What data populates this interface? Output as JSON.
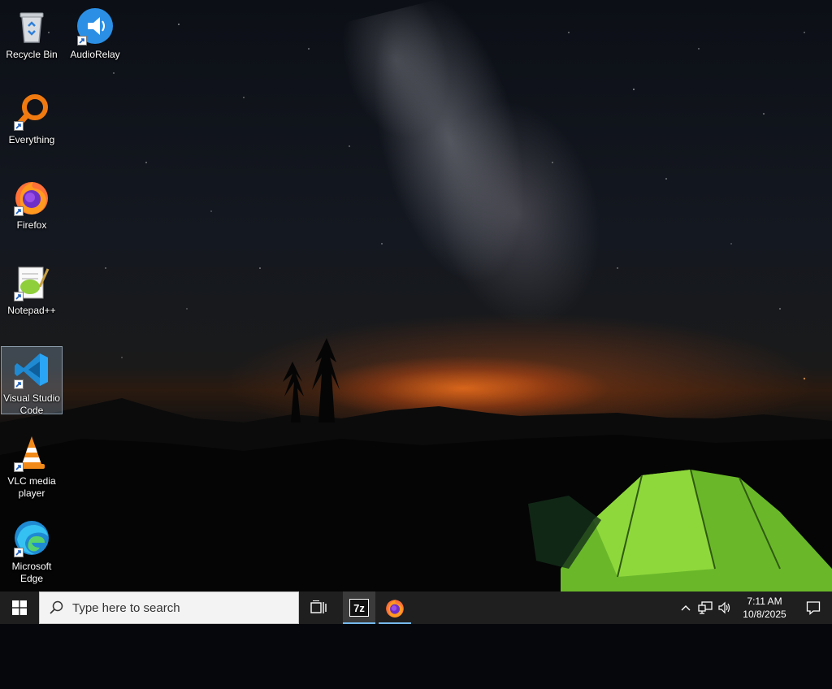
{
  "desktop": {
    "icons": [
      {
        "label": "Recycle Bin",
        "icon": "recycle-bin-icon"
      },
      {
        "label": "AudioRelay",
        "icon": "audiorelay-icon"
      },
      {
        "label": "Everything",
        "icon": "everything-search-icon"
      },
      {
        "label": "Firefox",
        "icon": "firefox-icon"
      },
      {
        "label": "Notepad++",
        "icon": "notepad-plus-plus-icon"
      },
      {
        "label": "Visual Studio Code",
        "icon": "vscode-icon"
      },
      {
        "label": "VLC media player",
        "icon": "vlc-icon"
      },
      {
        "label": "Microsoft Edge",
        "icon": "edge-icon"
      }
    ],
    "selected_icon": "Visual Studio Code"
  },
  "taskbar": {
    "search_placeholder": "Type here to search",
    "apps": [
      {
        "name": "7-Zip",
        "icon": "7zip-icon",
        "glyph": "7z"
      },
      {
        "name": "Firefox",
        "icon": "firefox-icon"
      }
    ],
    "tray": {
      "clock_time": "7:11 AM",
      "clock_date": "10/8/2025"
    }
  },
  "colors": {
    "taskbar_bg": "#1f1f1f",
    "accent": "#76b9ed",
    "search_bg": "#f3f3f3"
  }
}
